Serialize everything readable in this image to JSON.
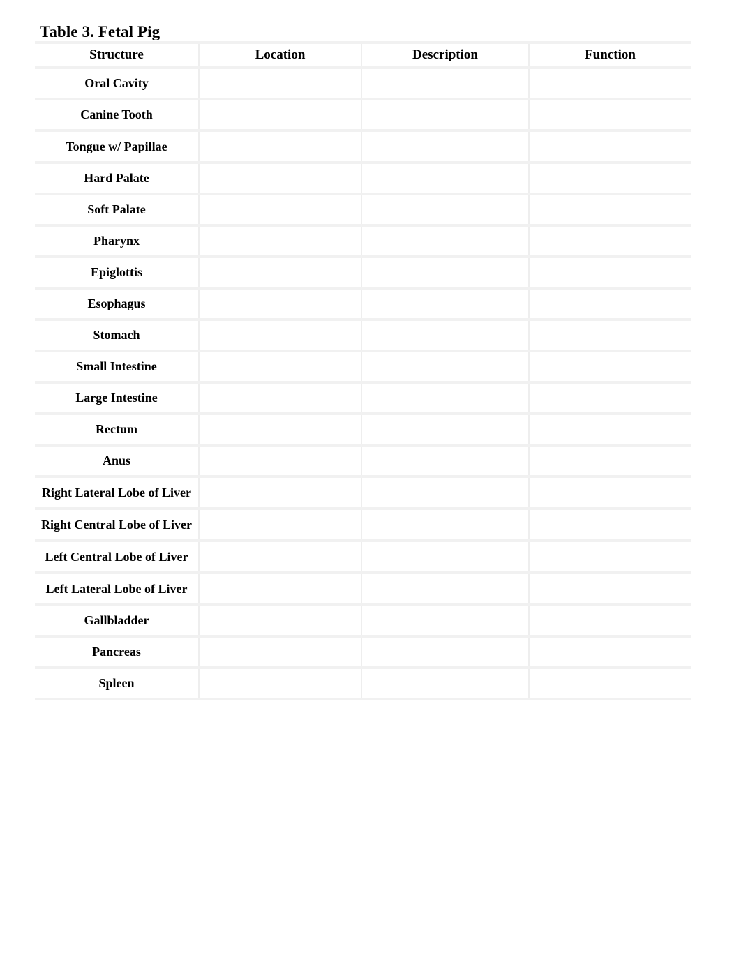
{
  "document": {
    "title": "Table 3. Fetal Pig"
  },
  "table": {
    "columns": [
      {
        "key": "structure",
        "label": "Structure"
      },
      {
        "key": "location",
        "label": "Location"
      },
      {
        "key": "description",
        "label": "Description"
      },
      {
        "key": "function",
        "label": "Function"
      }
    ],
    "rows": [
      {
        "structure": "Oral Cavity",
        "location": "",
        "description": "",
        "function": "",
        "lines": 1
      },
      {
        "structure": "Canine Tooth",
        "location": "",
        "description": "",
        "function": "",
        "lines": 1
      },
      {
        "structure": "Tongue w/ Papillae",
        "location": "",
        "description": "",
        "function": "",
        "lines": 2
      },
      {
        "structure": "Hard Palate",
        "location": "",
        "description": "",
        "function": "",
        "lines": 1
      },
      {
        "structure": "Soft Palate",
        "location": "",
        "description": "",
        "function": "",
        "lines": 1
      },
      {
        "structure": "Pharynx",
        "location": "",
        "description": "",
        "function": "",
        "lines": 1
      },
      {
        "structure": "Epiglottis",
        "location": "",
        "description": "",
        "function": "",
        "lines": 1
      },
      {
        "structure": "Esophagus",
        "location": "",
        "description": "",
        "function": "",
        "lines": 1
      },
      {
        "structure": "Stomach",
        "location": "",
        "description": "",
        "function": "",
        "lines": 1
      },
      {
        "structure": "Small Intestine",
        "location": "",
        "description": "",
        "function": "",
        "lines": 1
      },
      {
        "structure": "Large Intestine",
        "location": "",
        "description": "",
        "function": "",
        "lines": 1
      },
      {
        "structure": "Rectum",
        "location": "",
        "description": "",
        "function": "",
        "lines": 1
      },
      {
        "structure": "Anus",
        "location": "",
        "description": "",
        "function": "",
        "lines": 1
      },
      {
        "structure": "Right Lateral Lobe of Liver",
        "location": "",
        "description": "",
        "function": "",
        "lines": 2
      },
      {
        "structure": "Right Central Lobe of Liver",
        "location": "",
        "description": "",
        "function": "",
        "lines": 2
      },
      {
        "structure": "Left Central Lobe of Liver",
        "location": "",
        "description": "",
        "function": "",
        "lines": 2
      },
      {
        "structure": "Left Lateral Lobe of Liver",
        "location": "",
        "description": "",
        "function": "",
        "lines": 2
      },
      {
        "structure": "Gallbladder",
        "location": "",
        "description": "",
        "function": "",
        "lines": 1
      },
      {
        "structure": "Pancreas",
        "location": "",
        "description": "",
        "function": "",
        "lines": 1
      },
      {
        "structure": "Spleen",
        "location": "",
        "description": "",
        "function": "",
        "lines": 1
      }
    ]
  },
  "style": {
    "page_background": "#ffffff",
    "text_color": "#000000",
    "grid_line_color": "#f1f1f1",
    "column_line_color": "#eeeeee",
    "cell_background": "#ffffff"
  }
}
